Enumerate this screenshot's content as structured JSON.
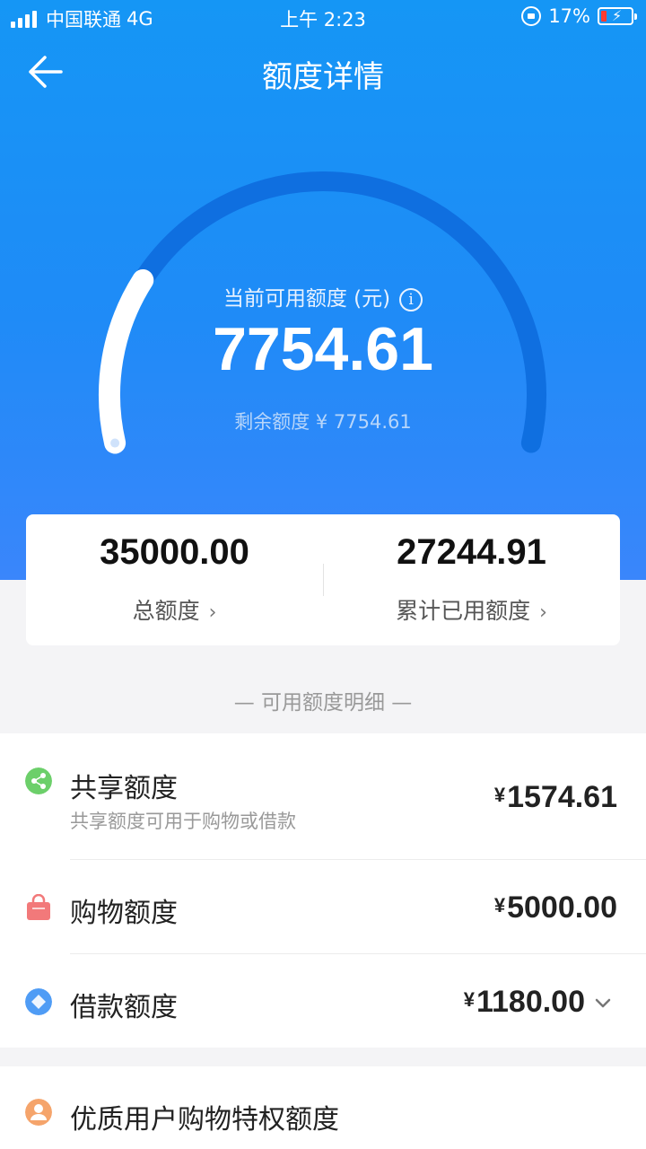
{
  "status_bar": {
    "carrier": "中国联通",
    "network": "4G",
    "time": "上午 2:23",
    "battery": "17%"
  },
  "nav": {
    "title": "额度详情"
  },
  "credit": {
    "label": "当前可用额度 (元)",
    "available": "7754.61",
    "remaining_text": "剩余额度 ¥ 7754.61",
    "used_fraction": 0.779
  },
  "summary": {
    "total_value": "35000.00",
    "total_label": "总额度",
    "used_value": "27244.91",
    "used_label": "累计已用额度"
  },
  "section": {
    "title": "— 可用额度明细 —"
  },
  "items": [
    {
      "title": "共享额度",
      "subtitle": "共享额度可用于购物或借款",
      "currency": "¥",
      "amount": "1574.61",
      "icon": "share-icon",
      "color": "#6ccf6a"
    },
    {
      "title": "购物额度",
      "currency": "¥",
      "amount": "5000.00",
      "icon": "shopping-bag-icon",
      "color": "#f2797a"
    },
    {
      "title": "借款额度",
      "currency": "¥",
      "amount": "1180.00",
      "icon": "diamond-icon",
      "color": "#4f9cf5"
    }
  ],
  "items2": [
    {
      "title": "优质用户购物特权额度",
      "icon": "user-icon",
      "color": "#f5a46b"
    }
  ],
  "colors": {
    "hero_blue": "#1596f5",
    "arc_track": "#0f6fe0"
  }
}
